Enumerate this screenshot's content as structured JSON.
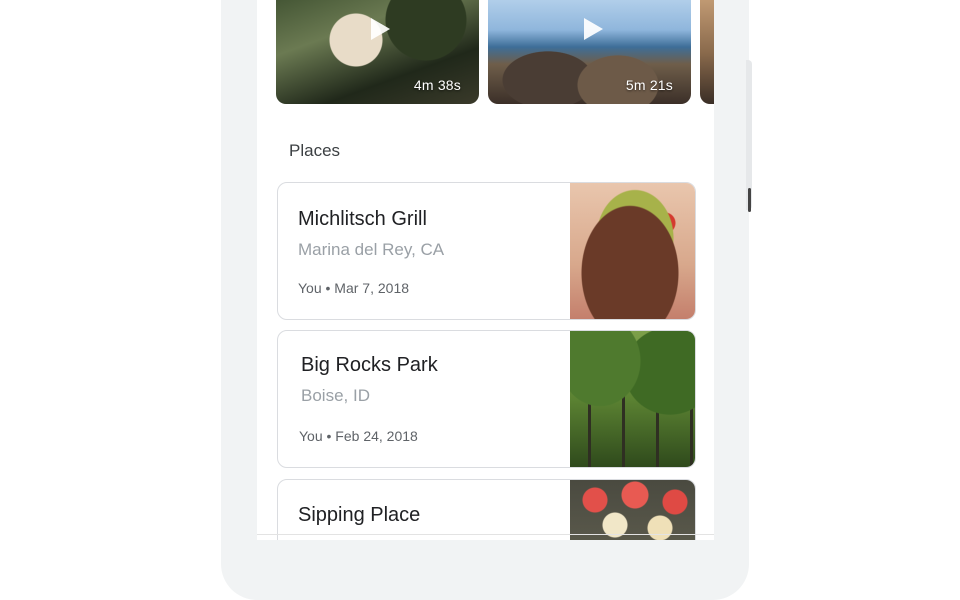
{
  "videos": [
    {
      "duration": "4m 38s",
      "icon": "play-icon"
    },
    {
      "duration": "5m 21s",
      "icon": "play-icon"
    }
  ],
  "places": {
    "title": "Places",
    "items": [
      {
        "name": "Michlitsch Grill",
        "location": "Marina del Rey, CA",
        "meta": "You • Mar 7, 2018"
      },
      {
        "name": "Big Rocks Park",
        "location": "Boise, ID",
        "meta": "You • Feb 24, 2018"
      },
      {
        "name": "Sipping Place",
        "location": "",
        "meta": ""
      }
    ]
  }
}
